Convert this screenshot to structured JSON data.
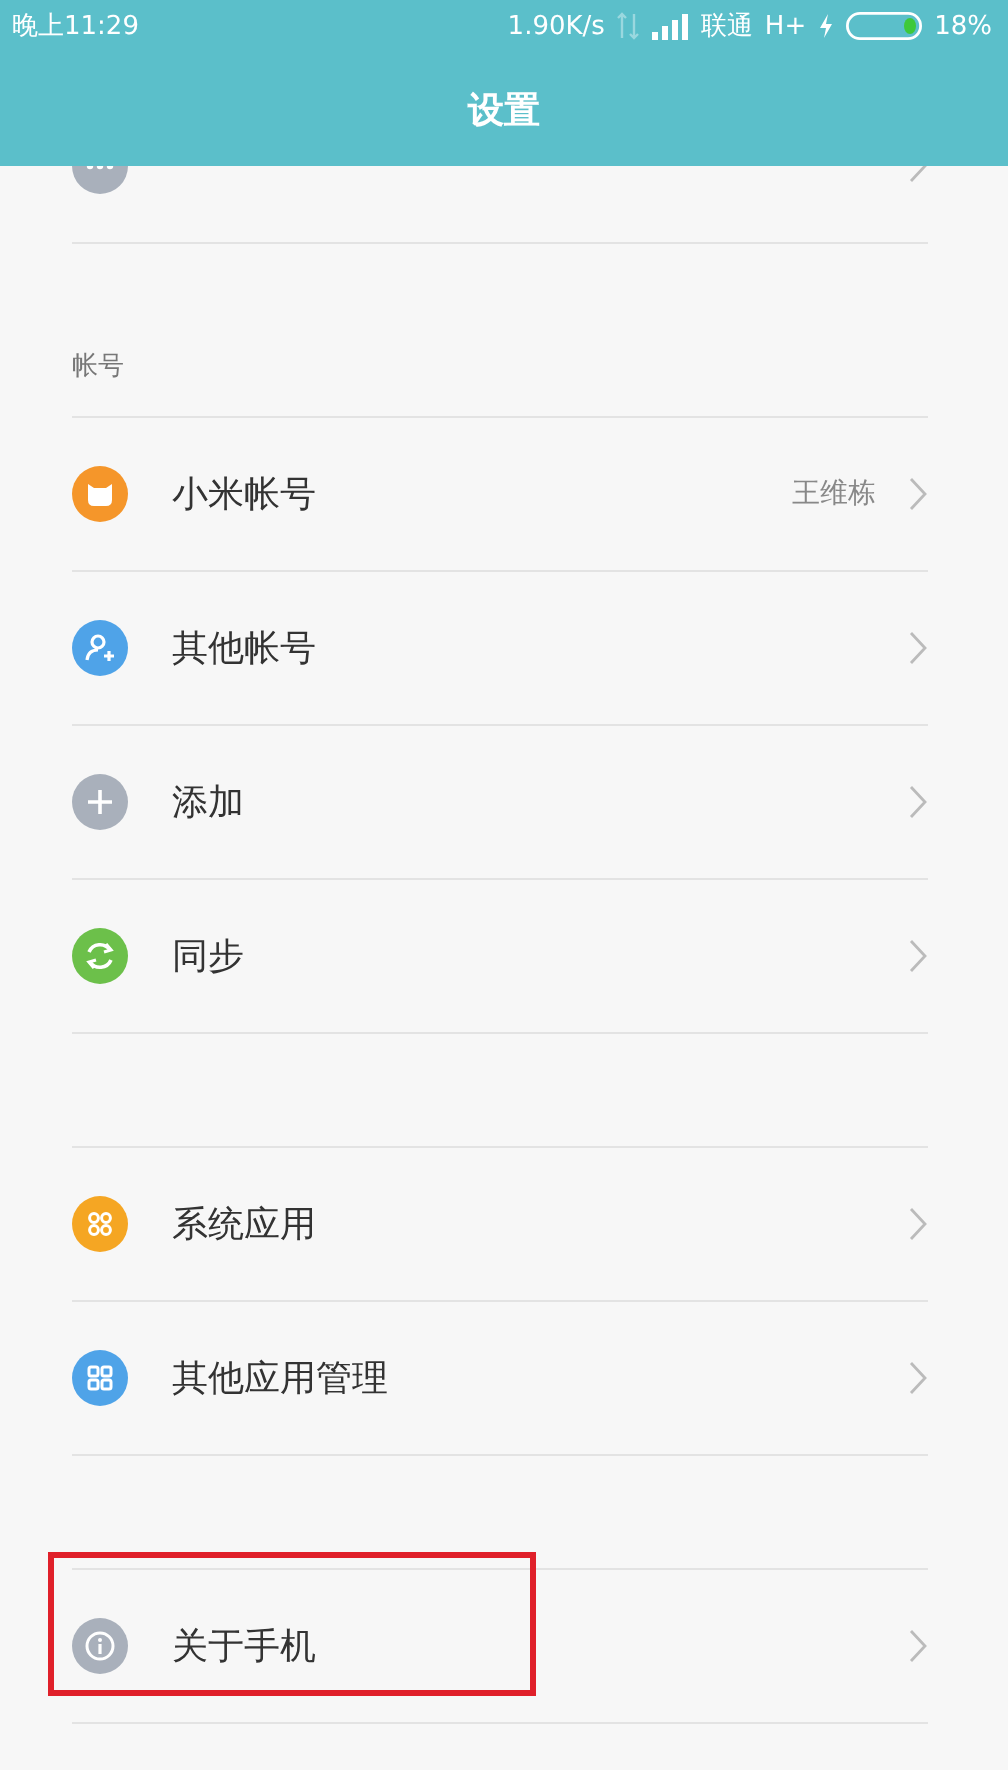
{
  "status_bar": {
    "time": "晚上11:29",
    "speed": "1.90K/s",
    "carrier": "联通",
    "network": "H+",
    "battery": "18%"
  },
  "header": {
    "title": "设置"
  },
  "partial_item": {
    "icon": {
      "kind": "more",
      "color": "#a9b0bb"
    }
  },
  "sections": [
    {
      "label": "帐号",
      "items": [
        {
          "label": "小米帐号",
          "value": "王维栋",
          "icon": {
            "kind": "mi",
            "color": "#f5962a"
          },
          "highlighted": false
        },
        {
          "label": "其他帐号",
          "icon": {
            "kind": "person-add",
            "color": "#4fa3e8"
          },
          "highlighted": false
        },
        {
          "label": "添加",
          "icon": {
            "kind": "plus",
            "color": "#a9b0bb"
          },
          "highlighted": false
        },
        {
          "label": "同步",
          "icon": {
            "kind": "sync",
            "color": "#6cc04a"
          },
          "highlighted": false
        }
      ]
    },
    {
      "items": [
        {
          "label": "系统应用",
          "icon": {
            "kind": "apps",
            "color": "#f5a623"
          },
          "highlighted": false
        },
        {
          "label": "其他应用管理",
          "icon": {
            "kind": "grid",
            "color": "#4fa3e8"
          },
          "highlighted": false
        }
      ]
    },
    {
      "items": [
        {
          "label": "关于手机",
          "icon": {
            "kind": "info",
            "color": "#a9b0bb"
          },
          "highlighted": true
        }
      ]
    }
  ]
}
